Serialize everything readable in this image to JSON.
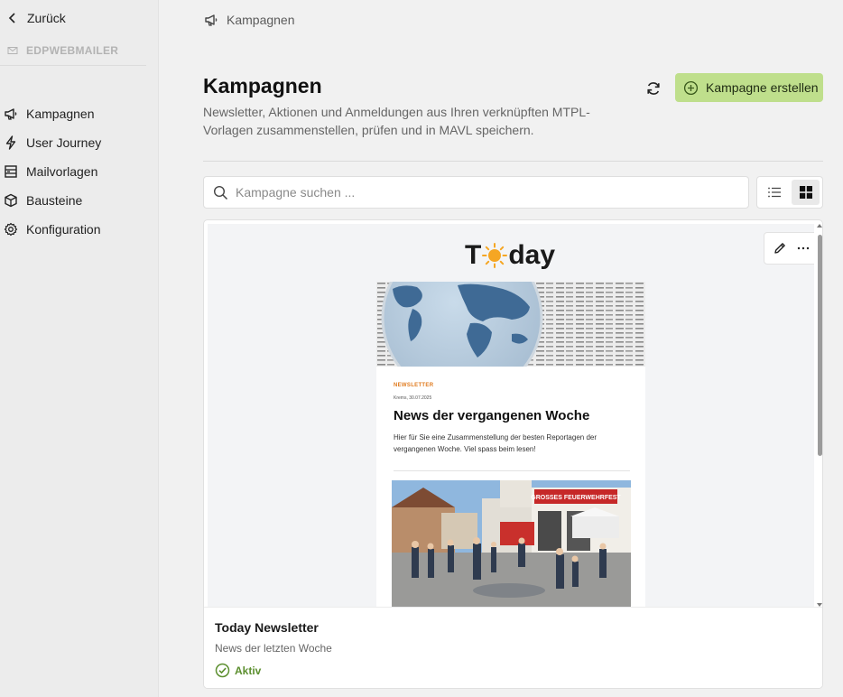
{
  "sidebar": {
    "back_label": "Zurück",
    "account_label": "EDPWEBMAILER",
    "items": [
      {
        "label": "Kampagnen",
        "icon": "megaphone-icon"
      },
      {
        "label": "User Journey",
        "icon": "lightning-icon"
      },
      {
        "label": "Mailvorlagen",
        "icon": "template-icon"
      },
      {
        "label": "Bausteine",
        "icon": "cube-icon"
      },
      {
        "label": "Konfiguration",
        "icon": "gear-icon"
      }
    ]
  },
  "breadcrumb": {
    "label": "Kampagnen"
  },
  "page": {
    "title": "Kampagnen",
    "description": "Newsletter, Aktionen und Anmeldungen aus Ihren verknüpften MTPL-Vorlagen zusammenstellen, prüfen und in MAVL speichern.",
    "create_button": "Kampagne erstellen"
  },
  "search": {
    "placeholder": "Kampagne suchen ...",
    "value": ""
  },
  "view_toggle": {
    "active": "grid"
  },
  "colors": {
    "accent": "#bfdf8c",
    "status_active": "#5c8f2f",
    "kicker": "#e07b1f"
  },
  "card": {
    "title": "Today Newsletter",
    "subtitle": "News der letzten Woche",
    "status": "Aktiv",
    "preview": {
      "logo_left": "T",
      "logo_right": "day",
      "kicker": "NEWSLETTER",
      "dateline": "Krems, 30.07.2025",
      "headline": "News der vergangenen Woche",
      "teaser": "Hier für Sie eine Zusammenstellung der besten Reportagen der vergangenen Woche. Viel spass beim lesen!",
      "photo_sign": "GROSSES FEUERWEHRFEST"
    }
  }
}
